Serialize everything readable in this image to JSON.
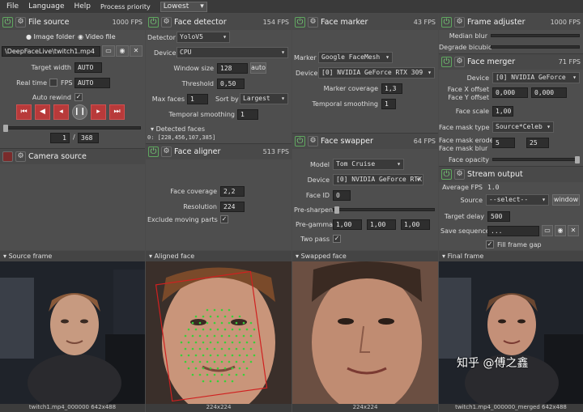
{
  "menu": {
    "file": "File",
    "language": "Language",
    "help": "Help",
    "priority_label": "Process priority",
    "priority_value": "Lowest"
  },
  "file_source": {
    "title": "File source",
    "fps": "1000 FPS",
    "image_folder": "Image folder",
    "video_file": "Video file",
    "path": "\\DeepFaceLive\\twitch1.mp4",
    "target_width_label": "Target width",
    "target_width": "AUTO",
    "realtime_label": "Real time",
    "fps_label": "FPS",
    "fps_value": "AUTO",
    "auto_rewind": "Auto rewind",
    "frame_current": "1",
    "frame_total": "368"
  },
  "camera_source": {
    "title": "Camera source"
  },
  "face_detector": {
    "title": "Face detector",
    "fps": "154 FPS",
    "detector_label": "Detector",
    "detector": "YoloV5",
    "device_label": "Device",
    "device": "CPU",
    "window_size_label": "Window size",
    "window_size": "128",
    "auto": "auto",
    "threshold_label": "Threshold",
    "threshold": "0,50",
    "max_faces_label": "Max faces",
    "max_faces": "1",
    "sort_by_label": "Sort by",
    "sort_by": "Largest",
    "temporal_label": "Temporal smoothing",
    "temporal": "1",
    "detected_label": "Detected faces",
    "detected_value": "0: [228,456,107,385]"
  },
  "face_aligner": {
    "title": "Face aligner",
    "fps": "513 FPS",
    "coverage_label": "Face coverage",
    "coverage": "2,2",
    "resolution_label": "Resolution",
    "resolution": "224",
    "exclude_label": "Exclude moving parts"
  },
  "face_marker": {
    "title": "Face marker",
    "fps": "43 FPS",
    "marker_label": "Marker",
    "marker": "Google FaceMesh",
    "device_label": "Device",
    "device": "[0] NVIDIA GeForce RTX 309",
    "coverage_label": "Marker coverage",
    "coverage": "1,3",
    "temporal_label": "Temporal smoothing",
    "temporal": "1"
  },
  "face_swapper": {
    "title": "Face swapper",
    "fps": "64 FPS",
    "model_label": "Model",
    "model": "Tom Cruise",
    "device_label": "Device",
    "device": "[0] NVIDIA GeForce RTX",
    "face_id_label": "Face ID",
    "face_id": "0",
    "presharpen_label": "Pre-sharpen",
    "pregamma_label": "Pre-gamma",
    "g1": "1,00",
    "g2": "1,00",
    "g3": "1,00",
    "two_pass_label": "Two pass"
  },
  "frame_adjuster": {
    "title": "Frame adjuster",
    "fps": "1000 FPS",
    "median_label": "Median blur",
    "degrade_label": "Degrade bicubic"
  },
  "face_merger": {
    "title": "Face merger",
    "fps": "71 FPS",
    "device_label": "Device",
    "device": "[0] NVIDIA GeForce",
    "offset_x_label": "Face X offset",
    "offset_y_label": "Face Y offset",
    "offset_x": "0,000",
    "offset_y": "0,000",
    "scale_label": "Face scale",
    "scale": "1,00",
    "mask_type_label": "Face mask type",
    "mask_type": "Source*Celeb",
    "erode_label": "Face mask erode",
    "blur_label": "Face mask blur",
    "erode": "5",
    "blur": "25",
    "opacity_label": "Face opacity"
  },
  "stream_output": {
    "title": "Stream output",
    "avg_fps_label": "Average FPS",
    "avg_fps": "1.0",
    "source_label": "Source",
    "source": "--select--",
    "window": "window",
    "delay_label": "Target delay",
    "delay": "500",
    "save_label": "Save sequence",
    "save_value": "...",
    "fill_gap": "Fill frame gap"
  },
  "frames": {
    "source": {
      "title": "Source frame",
      "caption": "twitch1.mp4_000000 642x488"
    },
    "aligned": {
      "title": "Aligned face",
      "caption": "224x224"
    },
    "swapped": {
      "title": "Swapped face",
      "caption": "224x224"
    },
    "final": {
      "title": "Final frame",
      "caption": "twitch1.mp4_000000_merged 642x488"
    }
  },
  "watermark": "知乎 @傅之鑫"
}
